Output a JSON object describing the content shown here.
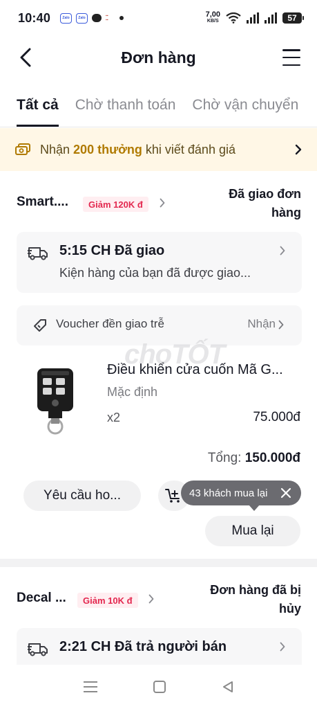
{
  "status_bar": {
    "time": "10:40",
    "net_speed_value": "7,00",
    "net_speed_unit": "KB/S",
    "battery": "57",
    "app_icon_1": "Zalo",
    "app_icon_2": "Zalo"
  },
  "header": {
    "title": "Đơn hàng"
  },
  "tabs": [
    {
      "label": "Tất cả",
      "active": true
    },
    {
      "label": "Chờ thanh toán",
      "active": false
    },
    {
      "label": "Chờ vận chuyển",
      "active": false
    }
  ],
  "promo": {
    "prefix": "Nhận ",
    "highlight": "200 thưởng",
    "suffix": " khi viết đánh giá"
  },
  "order1": {
    "shop_name": "Smart....",
    "discount_badge": "Giảm 120K đ",
    "status": "Đã giao đơn hàng",
    "delivery_title": "5:15 CH Đã giao",
    "delivery_subtitle": "Kiện hàng của bạn đã được giao...",
    "voucher_label": "Voucher đền giao trễ",
    "voucher_action": "Nhận",
    "product_name": "Điều khiển cửa cuốn Mã G...",
    "product_variant": "Mặc định",
    "product_qty": "x2",
    "product_price": "75.000đ",
    "total_label": "Tổng: ",
    "total_value": "150.000đ",
    "btn_invoice": "Yêu cầu ho...",
    "btn_rebuy": "Mua lại",
    "tooltip": "43 khách mua lại"
  },
  "watermark": "choTỐT",
  "order2": {
    "shop_name": "Decal ...",
    "discount_badge": "Giảm 10K đ",
    "status": "Đơn hàng đã bị hủy",
    "delivery_title": "2:21 CH Đã trả người bán"
  },
  "colors": {
    "accent_gold": "#b07a00",
    "promo_bg": "#fff7e6",
    "badge_red": "#e3284f",
    "badge_bg": "#ffeef1",
    "card_bg": "#f7f7f8"
  }
}
